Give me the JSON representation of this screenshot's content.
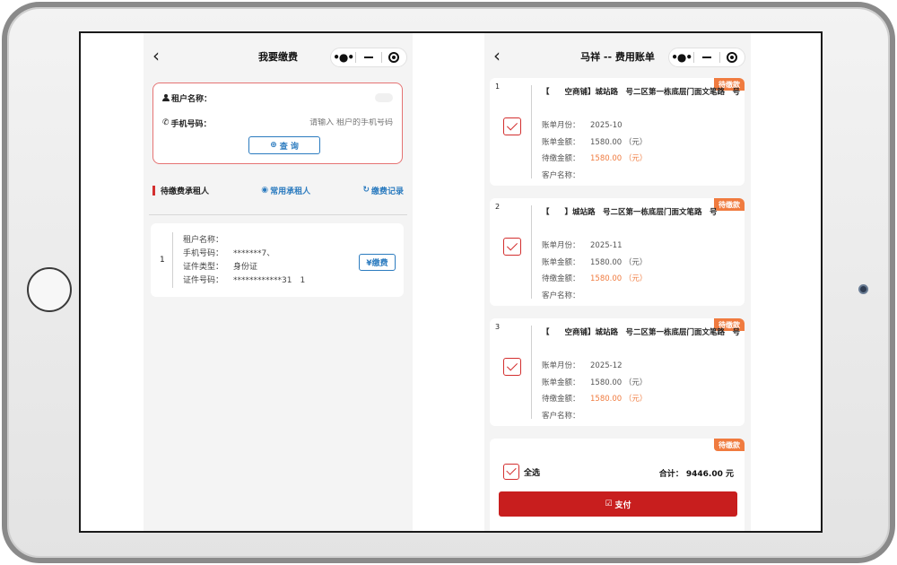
{
  "left": {
    "nav": {
      "back": "‹",
      "title": "我要缴费"
    },
    "search": {
      "name_label": "租户名称：",
      "name_value": "",
      "phone_label": "手机号码：",
      "phone_placeholder": "请输入 租户的手机号码",
      "query_button": "查 询"
    },
    "tabs": {
      "pending": "待缴费承租人",
      "frequent": "常用承租人",
      "history": "缴费记录"
    },
    "tenant": {
      "index": "1",
      "name_key": "租户名称：",
      "name_val": "",
      "phone_key": "手机号码：",
      "phone_val": "*******7、",
      "idtype_key": "证件类型：",
      "idtype_val": "身份证",
      "idno_key": "证件号码：",
      "idno_val": "************31　1",
      "pay_button": "¥缴费"
    }
  },
  "right": {
    "nav": {
      "back": "‹",
      "title": "马祥 -- 费用账单"
    },
    "bills": [
      {
        "index": "1",
        "badge": "待缴款",
        "address": "【　　空商铺】城站路　号二区第一栋底层门面文笔路　号",
        "month_key": "账单月份：",
        "month_val": "2025-10",
        "amount_key": "账单金额：",
        "amount_val": "1580.00 （元）",
        "due_key": "待缴金额：",
        "due_val": "1580.00 （元）",
        "customer_key": "客户名称：",
        "customer_val": ""
      },
      {
        "index": "2",
        "badge": "待缴款",
        "address": "【　　】城站路　号二区第一栋底层门面文笔路　号",
        "month_key": "账单月份：",
        "month_val": "2025-11",
        "amount_key": "账单金额：",
        "amount_val": "1580.00 （元）",
        "due_key": "待缴金额：",
        "due_val": "1580.00 （元）",
        "customer_key": "客户名称：",
        "customer_val": ""
      },
      {
        "index": "3",
        "badge": "待缴款",
        "address": "【　　空商铺】城站路　号二区第一栋底层门面文笔路　号",
        "month_key": "账单月份：",
        "month_val": "2025-12",
        "amount_key": "账单金额：",
        "amount_val": "1580.00 （元）",
        "due_key": "待缴金额：",
        "due_val": "1580.00 （元）",
        "customer_key": "客户名称：",
        "customer_val": ""
      },
      {
        "index": "",
        "badge": "待缴款"
      }
    ],
    "footer": {
      "select_all": "全选",
      "total": "合计： 9446.00 元",
      "pay_button": "支付"
    }
  },
  "colors": {
    "accent_red": "#c81e1e",
    "badge_orange": "#f07b3f",
    "link_blue": "#2b7bbf"
  }
}
